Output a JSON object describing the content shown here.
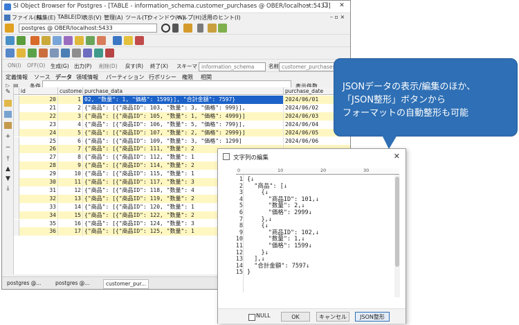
{
  "window": {
    "title": "SI Object Browser for Postgres - [TABLE - information_schema.customer_purchases @ OBER/localhost:5433]",
    "controls": [
      "–",
      "☐",
      "✕"
    ]
  },
  "menu": {
    "items": [
      "ファイル(F)",
      "編集(E)",
      "TABLE(D)",
      "表示(V)",
      "管理(A)",
      "ツール(T)",
      "ウィンドウ(W)",
      "ヘルプ(H)",
      "活用のヒント(I)"
    ],
    "mdi_controls": "– ▫ ×"
  },
  "connection": {
    "label": "postgres @ OBER/localhost:5433"
  },
  "sql_toolbar": {
    "items": [
      "ON(I)",
      "OFF(O)",
      "生成(G)",
      "出力(P)",
      "削除(D)",
      "戻す(R)",
      "終了(X)"
    ],
    "schema_label": "スキーマ",
    "schema_value": "information_schema",
    "name_label": "名前",
    "name_value": "customer_purchases"
  },
  "tabs": [
    "定義情報",
    "ソース",
    "データ",
    "領域情報",
    "パーティション",
    "行ポリシー",
    "権限",
    "相関"
  ],
  "filter": {
    "condition_label": "条件",
    "count_label": "表示件数"
  },
  "grid": {
    "columns": [
      "id",
      "customer_id",
      "purchase_data",
      "purchase_date"
    ],
    "rows": [
      {
        "id": "20",
        "cust": "1",
        "data": "02, \"数量\": 1, \"価格\": 1599}], \"合計金額\": 7597}",
        "date": "2024/06/01"
      },
      {
        "id": "21",
        "cust": "2",
        "data": "{\"商品\": [{\"商品ID\": 103, \"数量\": 3, \"価格\": 999}], ",
        "date": "2024/06/02"
      },
      {
        "id": "22",
        "cust": "3",
        "data": "{\"商品\": [{\"商品ID\": 105, \"数量\": 1, \"価格\": 4999}]",
        "date": "2024/06/03"
      },
      {
        "id": "23",
        "cust": "4",
        "data": "{\"商品\": [{\"商品ID\": 106, \"数量\": 5, \"価格\": 799}], ",
        "date": "2024/06/04"
      },
      {
        "id": "24",
        "cust": "5",
        "data": "{\"商品\": [{\"商品ID\": 107, \"数量\": 2, \"価格\": 2999}]",
        "date": "2024/06/05"
      },
      {
        "id": "25",
        "cust": "6",
        "data": "{\"商品\": [{\"商品ID\": 109, \"数量\": 3, \"価格\": 1299]",
        "date": "2024/06/06"
      },
      {
        "id": "26",
        "cust": "7",
        "data": "{\"商品\": [{\"商品ID\": 111, \"数量\": 2",
        "date": ""
      },
      {
        "id": "27",
        "cust": "8",
        "data": "{\"商品\": [{\"商品ID\": 112, \"数量\": 1",
        "date": ""
      },
      {
        "id": "28",
        "cust": "9",
        "data": "{\"商品\": [{\"商品ID\": 114, \"数量\": 2",
        "date": ""
      },
      {
        "id": "29",
        "cust": "10",
        "data": "{\"商品\": [{\"商品ID\": 115, \"数量\": 1",
        "date": ""
      },
      {
        "id": "30",
        "cust": "11",
        "data": "{\"商品\": [{\"商品ID\": 117, \"数量\": 3",
        "date": ""
      },
      {
        "id": "31",
        "cust": "12",
        "data": "{\"商品\": [{\"商品ID\": 118, \"数量\": 4",
        "date": ""
      },
      {
        "id": "32",
        "cust": "13",
        "data": "{\"商品\": [{\"商品ID\": 119, \"数量\": 2",
        "date": ""
      },
      {
        "id": "33",
        "cust": "14",
        "data": "{\"商品\": [{\"商品ID\": 120, \"数量\": 1",
        "date": ""
      },
      {
        "id": "34",
        "cust": "15",
        "data": "{\"商品\": [{\"商品ID\": 122, \"数量\": 2",
        "date": ""
      },
      {
        "id": "35",
        "cust": "16",
        "data": "{\"商品\": [{\"商品ID\": 124, \"数量\": 3",
        "date": ""
      },
      {
        "id": "36",
        "cust": "17",
        "data": "{\"商品\": [{\"商品ID\": 125, \"数量\": 1",
        "date": ""
      }
    ]
  },
  "status_tabs": [
    "postgres @...",
    "postgres @...",
    "customer_pur..."
  ],
  "callout": {
    "lines": [
      "JSONデータの表示/編集のほか、",
      "「JSON整形」ボタンから",
      "フォーマットの自動整形も可能"
    ],
    "color": "#2e6fb5"
  },
  "dialog": {
    "title": "文字列の編集",
    "close": "✕",
    "ruler": [
      "0",
      "10",
      "20",
      "30"
    ],
    "lines": [
      "{↓",
      "  \"商品\": [↓",
      "    {↓",
      "      \"商品ID\": 101,↓",
      "      \"数量\": 2,↓",
      "      \"価格\": 2999↓",
      "    },↓",
      "    {↓",
      "      \"商品ID\": 102,↓",
      "      \"数量\": 1,↓",
      "      \"価格\": 1599↓",
      "    }↓",
      "  ],↓",
      "  \"合計金額\": 7597↓",
      "}"
    ],
    "null_label": "NULL",
    "ok_label": "OK",
    "cancel_label": "キャンセル",
    "format_label": "JSON整形"
  }
}
